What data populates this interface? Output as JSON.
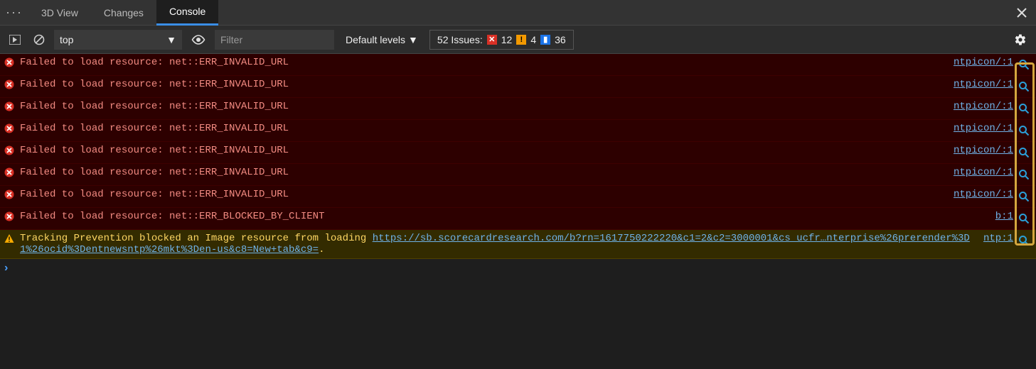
{
  "tabs": {
    "t0": "3D View",
    "t1": "Changes",
    "t2": "Console"
  },
  "toolbar": {
    "context": "top",
    "filter_placeholder": "Filter",
    "levels": "Default levels",
    "issues_label": "52 Issues:",
    "issues_red": "12",
    "issues_orange": "4",
    "issues_blue": "36"
  },
  "messages": [
    {
      "type": "error",
      "text": "Failed to load resource: net::ERR_INVALID_URL",
      "src": "ntpicon/:1"
    },
    {
      "type": "error",
      "text": "Failed to load resource: net::ERR_INVALID_URL",
      "src": "ntpicon/:1"
    },
    {
      "type": "error",
      "text": "Failed to load resource: net::ERR_INVALID_URL",
      "src": "ntpicon/:1"
    },
    {
      "type": "error",
      "text": "Failed to load resource: net::ERR_INVALID_URL",
      "src": "ntpicon/:1"
    },
    {
      "type": "error",
      "text": "Failed to load resource: net::ERR_INVALID_URL",
      "src": "ntpicon/:1"
    },
    {
      "type": "error",
      "text": "Failed to load resource: net::ERR_INVALID_URL",
      "src": "ntpicon/:1"
    },
    {
      "type": "error",
      "text": "Failed to load resource: net::ERR_INVALID_URL",
      "src": "ntpicon/:1"
    },
    {
      "type": "error",
      "text": "Failed to load resource: net::ERR_BLOCKED_BY_CLIENT",
      "src": "b:1"
    },
    {
      "type": "warning",
      "text": "Tracking Prevention blocked an Image resource from loading ",
      "link": "https://sb.scorecardresearch.com/b?rn=1617750222220&c1=2&c2=3000001&cs_ucfr…nterprise%26prerender%3D1%26ocid%3Dentnewsntp%26mkt%3Den-us&c8=New+tab&c9=",
      "tail": ".",
      "src": "ntp:1"
    }
  ]
}
